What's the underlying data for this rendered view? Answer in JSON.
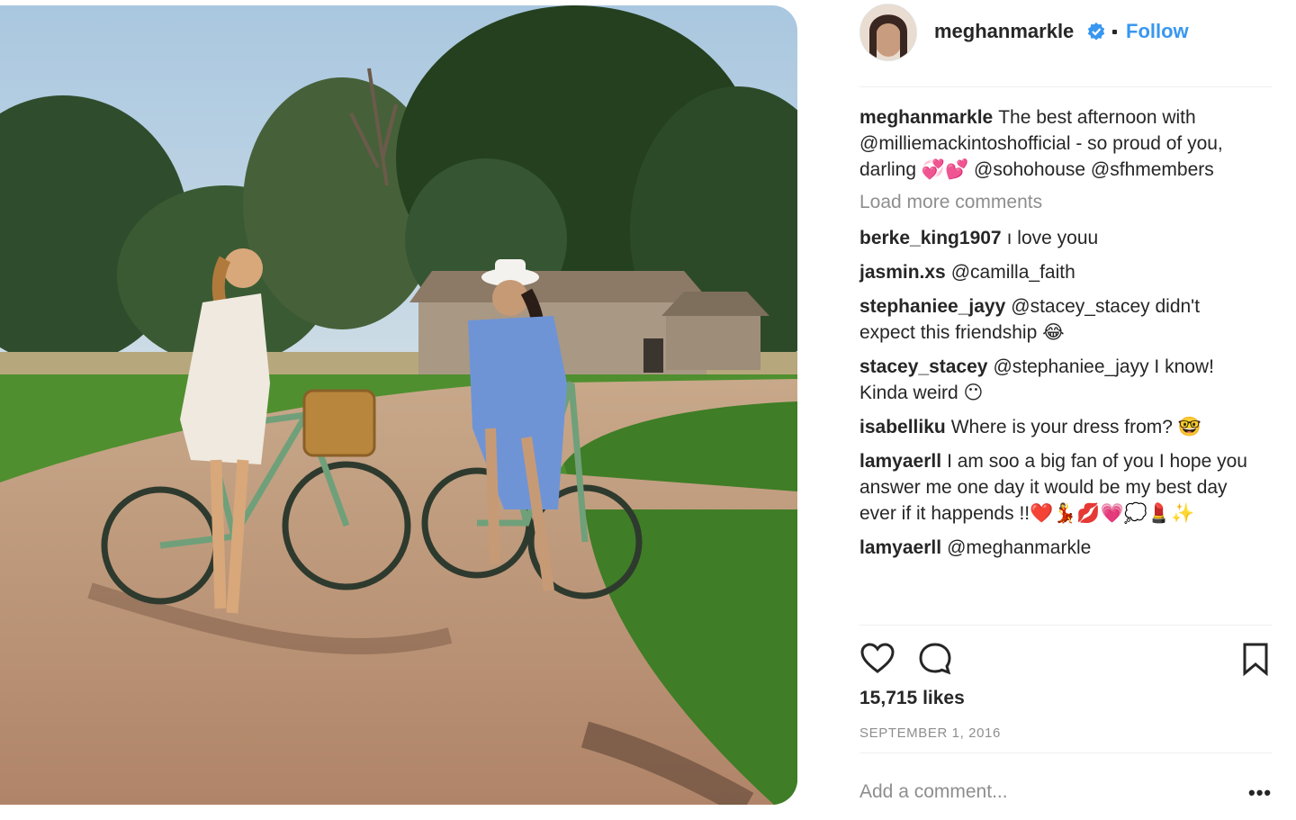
{
  "post": {
    "username": "meghanmarkle",
    "separator": "•",
    "follow_label": "Follow",
    "caption": "The best afternoon with @milliemackintoshofficial - so proud of you, darling 💞💕 @sohohouse @sfhmembers",
    "load_more": "Load more comments",
    "likes": "15,715 likes",
    "date": "SEPTEMBER 1, 2016",
    "add_comment_placeholder": "Add a comment...",
    "more_label": "•••"
  },
  "comments": [
    {
      "user": "berke_king1907",
      "text": "ı love youu"
    },
    {
      "user": "jasmin.xs",
      "text": "@camilla_faith"
    },
    {
      "user": "stephaniee_jayy",
      "text": "@stacey_stacey didn't expect this friendship 😂"
    },
    {
      "user": "stacey_stacey",
      "text": "@stephaniee_jayy I know! Kinda weird 😶"
    },
    {
      "user": "isabelliku",
      "text": "Where is your dress from? 🤓"
    },
    {
      "user": "lamyaerll",
      "text": "I am soo a big fan of you I hope you answer me one day it would be my best day ever if it happends !!❤️💃💋💗💭💄✨"
    },
    {
      "user": "lamyaerll",
      "text": "@meghanmarkle"
    }
  ],
  "icons": {
    "verified": "verified-badge-icon",
    "like": "heart-icon",
    "comment": "comment-bubble-icon",
    "save": "bookmark-icon"
  },
  "colors": {
    "link": "#3897f0",
    "text": "#262626",
    "muted": "#8e8e8e",
    "divider": "#efefef"
  }
}
